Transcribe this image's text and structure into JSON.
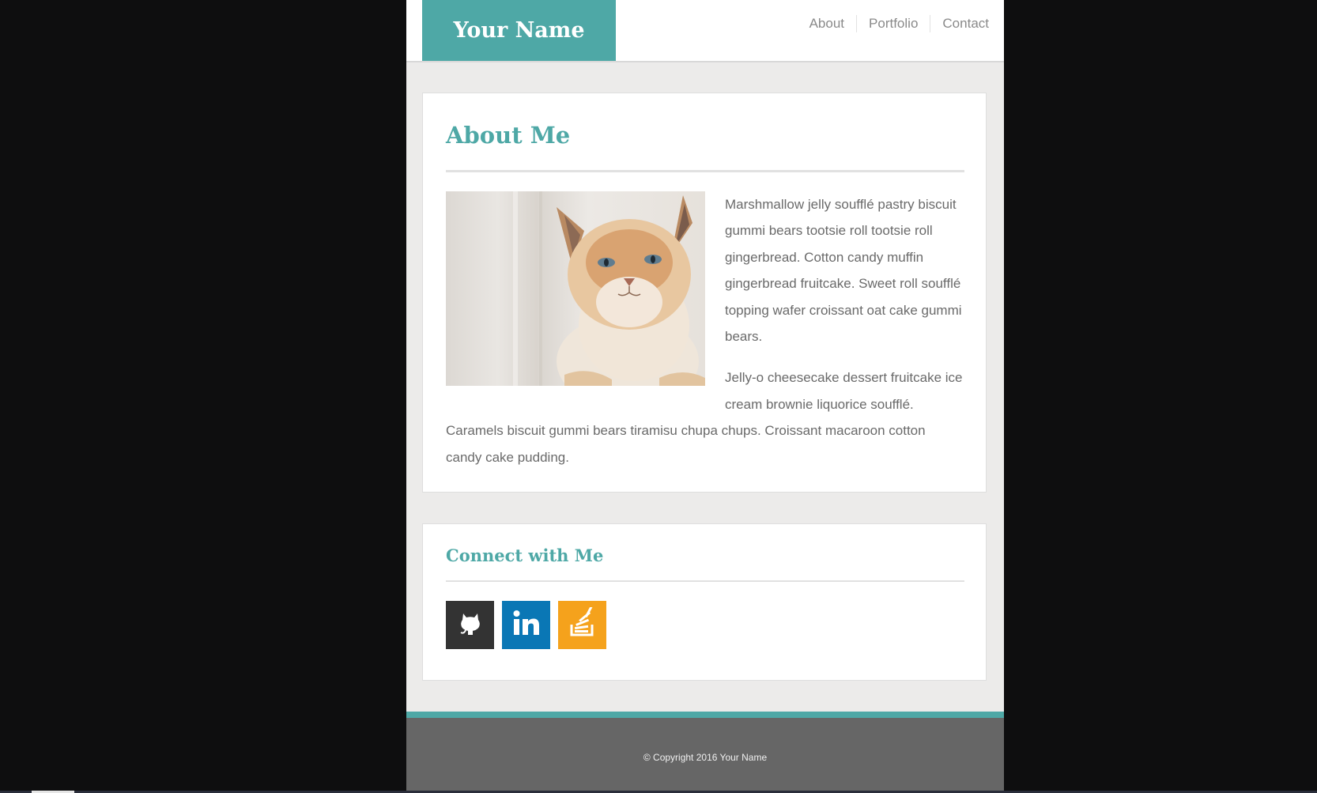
{
  "header": {
    "logo_text": "Your Name",
    "nav": [
      {
        "label": "About"
      },
      {
        "label": "Portfolio"
      },
      {
        "label": "Contact"
      }
    ]
  },
  "about": {
    "title": "About Me",
    "paragraphs": [
      "Marshmallow jelly soufflé pastry biscuit gummi bears tootsie roll tootsie roll gingerbread. Cotton candy muffin gingerbread fruitcake. Sweet roll soufflé topping wafer croissant oat cake gummi bears.",
      "Jelly-o cheesecake dessert fruitcake ice cream brownie liquorice soufflé. Caramels biscuit gummi bears tiramisu chupa chups. Croissant macaroon cotton candy cake pudding."
    ]
  },
  "connect": {
    "title": "Connect with Me",
    "links": [
      {
        "icon": "github-icon",
        "color": "#333333"
      },
      {
        "icon": "linkedin-icon",
        "color": "#0a77b5"
      },
      {
        "icon": "stackoverflow-icon",
        "color": "#f5a21c"
      }
    ]
  },
  "footer": {
    "copyright": "© Copyright 2016 Your Name"
  },
  "colors": {
    "accent": "#4ea8a6",
    "footer_bg": "#666666",
    "page_bg": "#ecebea"
  }
}
